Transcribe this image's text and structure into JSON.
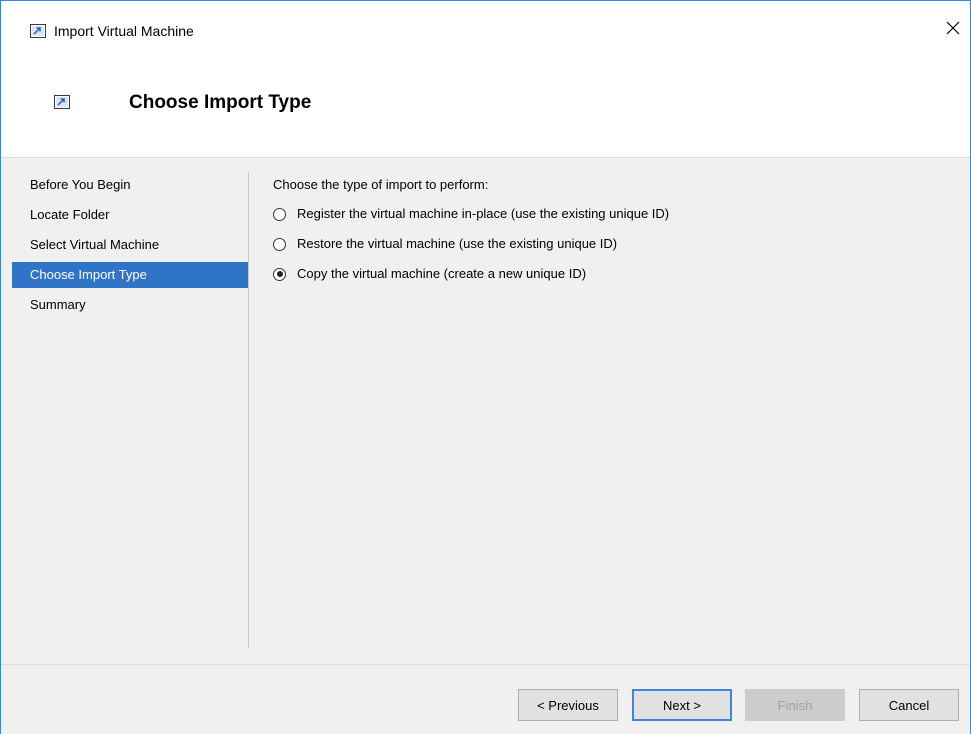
{
  "window": {
    "title": "Import Virtual Machine",
    "close_glyph": "✕",
    "icon": "import-vm-icon"
  },
  "header": {
    "title": "Choose Import Type",
    "icon": "import-vm-icon"
  },
  "nav": {
    "items": [
      {
        "label": "Before You Begin",
        "active": false
      },
      {
        "label": "Locate Folder",
        "active": false
      },
      {
        "label": "Select Virtual Machine",
        "active": false
      },
      {
        "label": "Choose Import Type",
        "active": true
      },
      {
        "label": "Summary",
        "active": false
      }
    ]
  },
  "main": {
    "prompt": "Choose the type of import to perform:",
    "options": [
      {
        "label": "Register the virtual machine in-place (use the existing unique ID)",
        "checked": false
      },
      {
        "label": "Restore the virtual machine (use the existing unique ID)",
        "checked": false
      },
      {
        "label": "Copy the virtual machine (create a new unique ID)",
        "checked": true
      }
    ]
  },
  "footer": {
    "previous_label": "< Previous",
    "next_label": "Next >",
    "finish_label": "Finish",
    "cancel_label": "Cancel"
  },
  "colors": {
    "accent": "#2f74c7",
    "window_border": "#3c86d6",
    "panel_bg": "#f0f0f0"
  }
}
